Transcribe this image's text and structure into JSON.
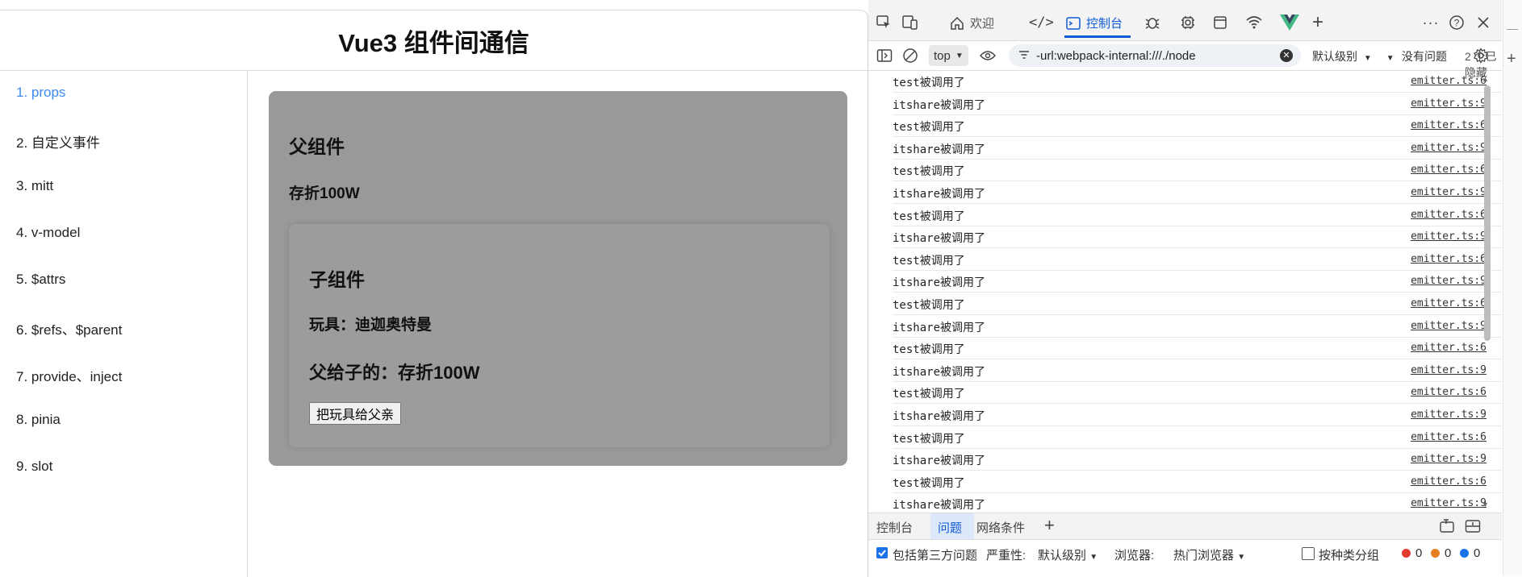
{
  "app": {
    "title": "Vue3 组件间通信",
    "nav": [
      {
        "label": "1. props",
        "active": true
      },
      {
        "label": "2. 自定义事件",
        "active": false
      },
      {
        "label": "3. mitt",
        "active": false
      },
      {
        "label": "4. v-model",
        "active": false
      },
      {
        "label": "5. $attrs",
        "active": false
      },
      {
        "label": "6. $refs、$parent",
        "active": false
      },
      {
        "label": "7. provide、inject",
        "active": false
      },
      {
        "label": "8. pinia",
        "active": false
      },
      {
        "label": "9. slot",
        "active": false
      }
    ],
    "parent": {
      "title": "父组件",
      "money": "存折100W"
    },
    "child": {
      "title": "子组件",
      "toy": "玩具：迪迦奥特曼",
      "from_parent": "父给子的：存折100W",
      "button_label": "把玩具给父亲"
    },
    "colors": {
      "active_link": "#3d8bf2",
      "parent_bg": "#999999",
      "child_bg": "#9c9c9c"
    }
  },
  "devtools": {
    "tabs": [
      {
        "label": "欢迎",
        "icon": "home-icon"
      },
      {
        "label": "",
        "icon": "code-icon"
      },
      {
        "label": "控制台",
        "icon": "console-icon",
        "active": true
      }
    ],
    "toolbar": {
      "context": "top",
      "filter": "-url:webpack-internal:///./node",
      "level": "默认级别",
      "issues": "没有问题",
      "hidden": "2 个已隐藏"
    },
    "logs": [
      {
        "msg": "test被调用了",
        "src": "emitter.ts:6"
      },
      {
        "msg": "itshare被调用了",
        "src": "emitter.ts:9"
      },
      {
        "msg": "test被调用了",
        "src": "emitter.ts:6"
      },
      {
        "msg": "itshare被调用了",
        "src": "emitter.ts:9"
      },
      {
        "msg": "test被调用了",
        "src": "emitter.ts:6"
      },
      {
        "msg": "itshare被调用了",
        "src": "emitter.ts:9"
      },
      {
        "msg": "test被调用了",
        "src": "emitter.ts:6"
      },
      {
        "msg": "itshare被调用了",
        "src": "emitter.ts:9"
      },
      {
        "msg": "test被调用了",
        "src": "emitter.ts:6"
      },
      {
        "msg": "itshare被调用了",
        "src": "emitter.ts:9"
      },
      {
        "msg": "test被调用了",
        "src": "emitter.ts:6"
      },
      {
        "msg": "itshare被调用了",
        "src": "emitter.ts:9"
      },
      {
        "msg": "test被调用了",
        "src": "emitter.ts:6"
      },
      {
        "msg": "itshare被调用了",
        "src": "emitter.ts:9"
      },
      {
        "msg": "test被调用了",
        "src": "emitter.ts:6"
      },
      {
        "msg": "itshare被调用了",
        "src": "emitter.ts:9"
      },
      {
        "msg": "test被调用了",
        "src": "emitter.ts:6"
      },
      {
        "msg": "itshare被调用了",
        "src": "emitter.ts:9"
      },
      {
        "msg": "test被调用了",
        "src": "emitter.ts:6"
      },
      {
        "msg": "itshare被调用了",
        "src": "emitter.ts:9"
      }
    ],
    "drawer": {
      "tabs": [
        {
          "label": "控制台",
          "active": false
        },
        {
          "label": "问题",
          "active": true
        },
        {
          "label": "网络条件",
          "active": false
        }
      ]
    },
    "issues_bar": {
      "include_third_party": "包括第三方问题",
      "include_checked": true,
      "severity_label": "严重性:",
      "severity_value": "默认级别",
      "browser_label": "浏览器:",
      "browser_value": "热门浏览器",
      "group_by_category": "按种类分组",
      "errors": "0",
      "warnings": "0",
      "infos": "0"
    },
    "colors": {
      "accent": "#0f5bd3",
      "error": "#e23b2e",
      "warning": "#e67e22",
      "info": "#1a73e8"
    }
  }
}
